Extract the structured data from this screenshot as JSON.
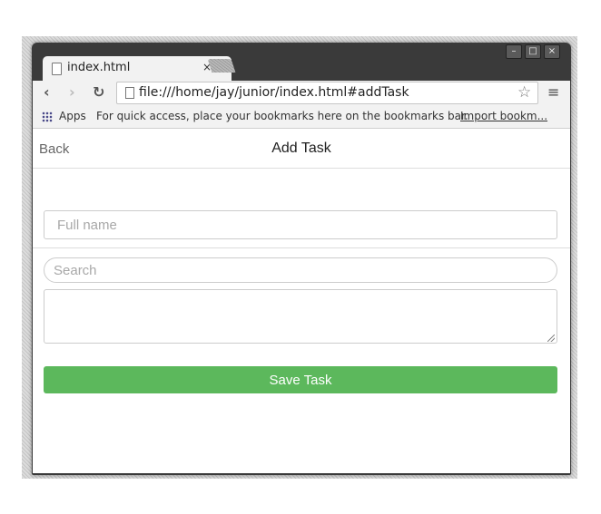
{
  "browser": {
    "tab_title": "index.html",
    "tab_close": "×",
    "url": "file:///home/jay/junior/index.html#addTask",
    "window_buttons": {
      "minimize": "–",
      "maximize": "□",
      "close": "×"
    },
    "nav_icons": {
      "back": "‹",
      "forward": "›",
      "reload": "↻"
    },
    "star": "☆",
    "menu": "≡",
    "bookmarks": {
      "apps_label": "Apps",
      "hint": "For quick access, place your bookmarks here on the bookmarks bar.",
      "import_link": "Import bookm..."
    }
  },
  "page": {
    "back_label": "Back",
    "title": "Add Task",
    "full_name_placeholder": "Full name",
    "search_placeholder": "Search",
    "save_label": "Save Task"
  },
  "colors": {
    "save_button": "#5cb85c",
    "window_frame": "#3a3a3a",
    "toolbar": "#f2f2f2"
  }
}
